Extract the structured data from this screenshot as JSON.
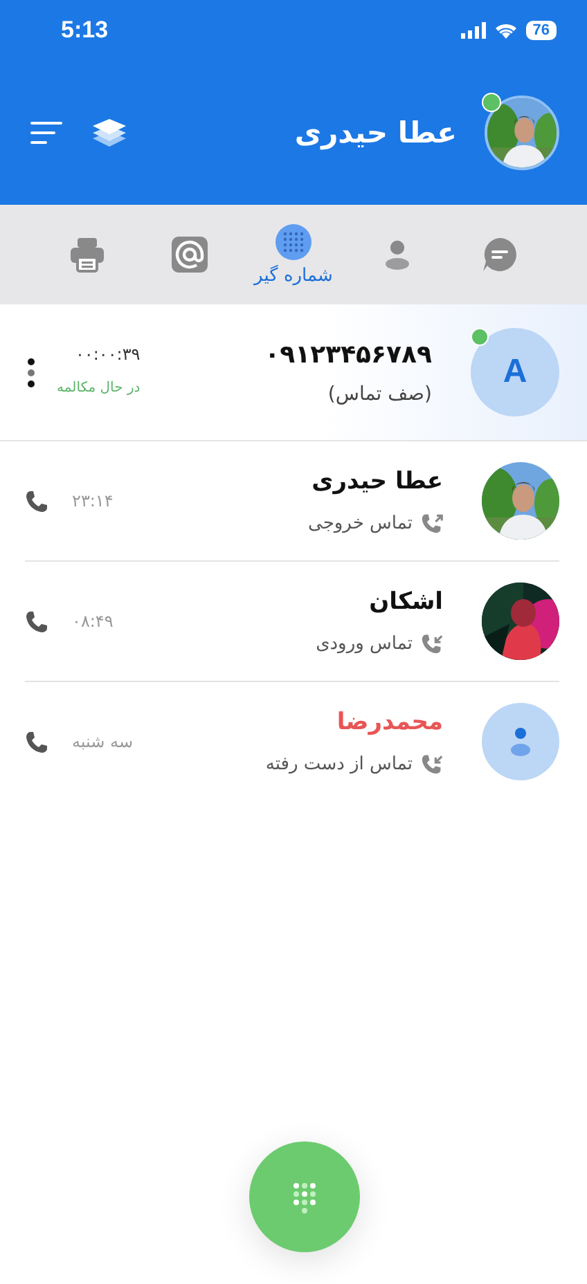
{
  "status_bar": {
    "time": "5:13",
    "battery": "76"
  },
  "header": {
    "title": "عطا حیدری",
    "online": true
  },
  "tabs": [
    {
      "kind": "printer",
      "selected": false
    },
    {
      "kind": "at",
      "selected": false
    },
    {
      "kind": "dialpad",
      "label": "شماره گیر",
      "selected": true
    },
    {
      "kind": "person",
      "selected": false
    },
    {
      "kind": "chat",
      "selected": false
    }
  ],
  "active_call": {
    "number": "۰۹۱۲۳۴۵۶۷۸۹",
    "subtitle": "(صف تماس)",
    "timer": "۰۰:۰۰:۳۹",
    "status": "در حال مکالمه",
    "avatar_letter": "A",
    "online": true
  },
  "calls": [
    {
      "name": "عطا حیدری",
      "kind": "outgoing",
      "type_label": "تماس خروجی",
      "time": "۲۳:۱۴"
    },
    {
      "name": "اشکان",
      "kind": "incoming",
      "type_label": "تماس ورودی",
      "time": "۰۸:۴۹"
    },
    {
      "name": "محمدرضا",
      "kind": "missed",
      "type_label": "تماس از دست رفته",
      "time": "سه شنبه",
      "avatar": {
        "kind": "silhouette"
      }
    }
  ]
}
